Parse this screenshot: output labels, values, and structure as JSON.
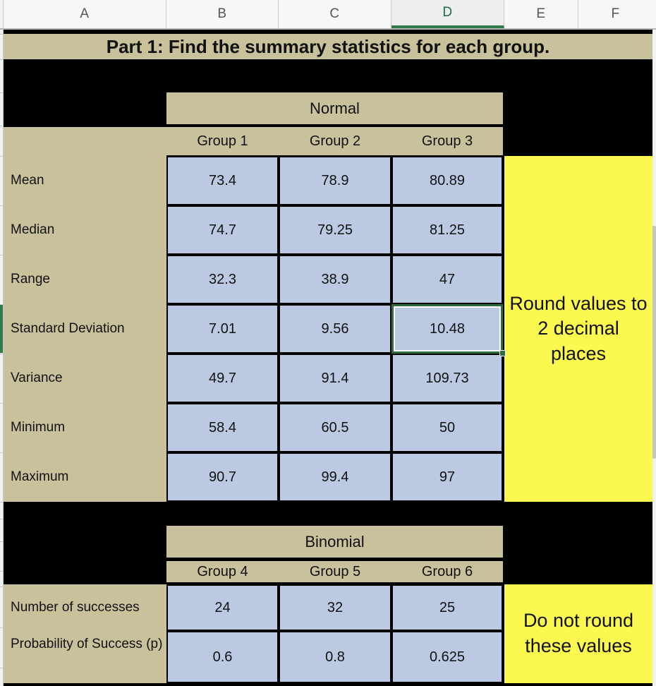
{
  "spreadsheet": {
    "column_headers": [
      "A",
      "B",
      "C",
      "D",
      "E",
      "F"
    ],
    "selected_column": "D",
    "title": "Part 1: Find the summary statistics for each group."
  },
  "normal_section": {
    "heading": "Normal",
    "group_headers": [
      "Group 1",
      "Group 2",
      "Group 3"
    ],
    "rows": [
      {
        "label": "Mean",
        "values": [
          "73.4",
          "78.9",
          "80.89"
        ]
      },
      {
        "label": "Median",
        "values": [
          "74.7",
          "79.25",
          "81.25"
        ]
      },
      {
        "label": "Range",
        "values": [
          "32.3",
          "38.9",
          "47"
        ]
      },
      {
        "label": "Standard Deviation",
        "values": [
          "7.01",
          "9.56",
          "10.48"
        ]
      },
      {
        "label": "Variance",
        "values": [
          "49.7",
          "91.4",
          "109.73"
        ]
      },
      {
        "label": "Minimum",
        "values": [
          "58.4",
          "60.5",
          "50"
        ]
      },
      {
        "label": "Maximum",
        "values": [
          "90.7",
          "99.4",
          "97"
        ]
      }
    ],
    "note": "Round values to 2 decimal places"
  },
  "binomial_section": {
    "heading": "Binomial",
    "group_headers": [
      "Group 4",
      "Group 5",
      "Group 6"
    ],
    "rows": [
      {
        "label": "Number of successes",
        "values": [
          "24",
          "32",
          "25"
        ]
      },
      {
        "label": "Probability of Success (p)",
        "values": [
          "0.6",
          "0.8",
          "0.625"
        ]
      }
    ],
    "note": "Do not round these values"
  },
  "selection": {
    "active_cell_value": "10.48",
    "active_cell_row_label": "Standard Deviation",
    "active_cell_group": "Group 3"
  },
  "colors": {
    "header_tan": "#c8c19b",
    "data_blue": "#bcc9e3",
    "note_yellow": "#fbf94f",
    "selection_green": "#2e6b3e",
    "background": "#000000"
  }
}
